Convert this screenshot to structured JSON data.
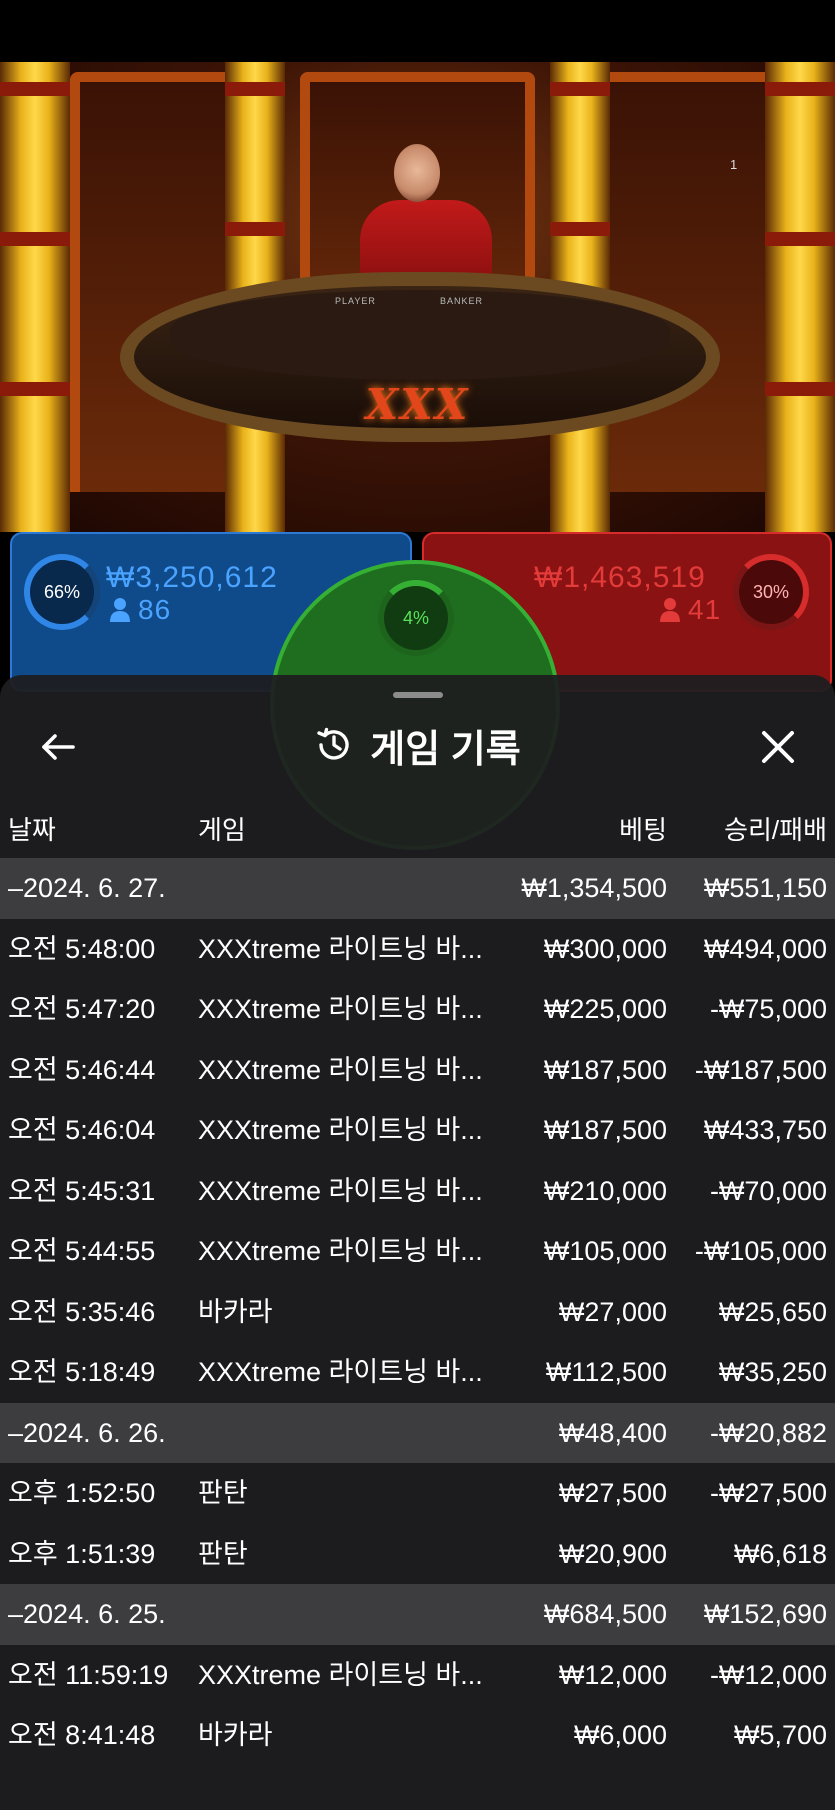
{
  "scene": {
    "corner_number": "1",
    "table_logo": "XXX",
    "table_labels": [
      "PLAYER",
      "BANKER"
    ]
  },
  "betting": {
    "player": {
      "percent": "66%",
      "amount": "₩3,250,612",
      "players": "86",
      "color": "#2f86e6"
    },
    "banker": {
      "percent": "30%",
      "amount": "₩1,463,519",
      "players": "41",
      "color": "#d62c2c"
    },
    "tie": {
      "percent": "4%",
      "color": "#35b035"
    }
  },
  "history": {
    "title": "게임 기록",
    "columns": {
      "time": "날짜",
      "game": "게임",
      "bet": "베팅",
      "result": "승리/패배"
    },
    "rows": [
      {
        "type": "date",
        "time": "–2024. 6. 27.",
        "game": "",
        "bet": "₩1,354,500",
        "result": "₩551,150"
      },
      {
        "type": "entry",
        "time": "오전 5:48:00",
        "game": "XXXtreme 라이트닝 바...",
        "bet": "₩300,000",
        "result": "₩494,000"
      },
      {
        "type": "entry",
        "time": "오전 5:47:20",
        "game": "XXXtreme 라이트닝 바...",
        "bet": "₩225,000",
        "result": "-₩75,000"
      },
      {
        "type": "entry",
        "time": "오전 5:46:44",
        "game": "XXXtreme 라이트닝 바...",
        "bet": "₩187,500",
        "result": "-₩187,500"
      },
      {
        "type": "entry",
        "time": "오전 5:46:04",
        "game": "XXXtreme 라이트닝 바...",
        "bet": "₩187,500",
        "result": "₩433,750"
      },
      {
        "type": "entry",
        "time": "오전 5:45:31",
        "game": "XXXtreme 라이트닝 바...",
        "bet": "₩210,000",
        "result": "-₩70,000"
      },
      {
        "type": "entry",
        "time": "오전 5:44:55",
        "game": "XXXtreme 라이트닝 바...",
        "bet": "₩105,000",
        "result": "-₩105,000"
      },
      {
        "type": "entry",
        "time": "오전 5:35:46",
        "game": "바카라",
        "bet": "₩27,000",
        "result": "₩25,650"
      },
      {
        "type": "entry",
        "time": "오전 5:18:49",
        "game": "XXXtreme 라이트닝 바...",
        "bet": "₩112,500",
        "result": "₩35,250"
      },
      {
        "type": "date",
        "time": "–2024. 6. 26.",
        "game": "",
        "bet": "₩48,400",
        "result": "-₩20,882"
      },
      {
        "type": "entry",
        "time": "오후 1:52:50",
        "game": "판탄",
        "bet": "₩27,500",
        "result": "-₩27,500"
      },
      {
        "type": "entry",
        "time": "오후 1:51:39",
        "game": "판탄",
        "bet": "₩20,900",
        "result": "₩6,618"
      },
      {
        "type": "date",
        "time": "–2024. 6. 25.",
        "game": "",
        "bet": "₩684,500",
        "result": "₩152,690"
      },
      {
        "type": "entry",
        "time": "오전 11:59:19",
        "game": "XXXtreme 라이트닝 바...",
        "bet": "₩12,000",
        "result": "-₩12,000"
      },
      {
        "type": "entry",
        "time": "오전 8:41:48",
        "game": "바카라",
        "bet": "₩6,000",
        "result": "₩5,700"
      }
    ]
  },
  "icons": {
    "back": "arrow-left-icon",
    "history": "history-clock-icon",
    "close": "close-icon",
    "person": "person-icon"
  }
}
